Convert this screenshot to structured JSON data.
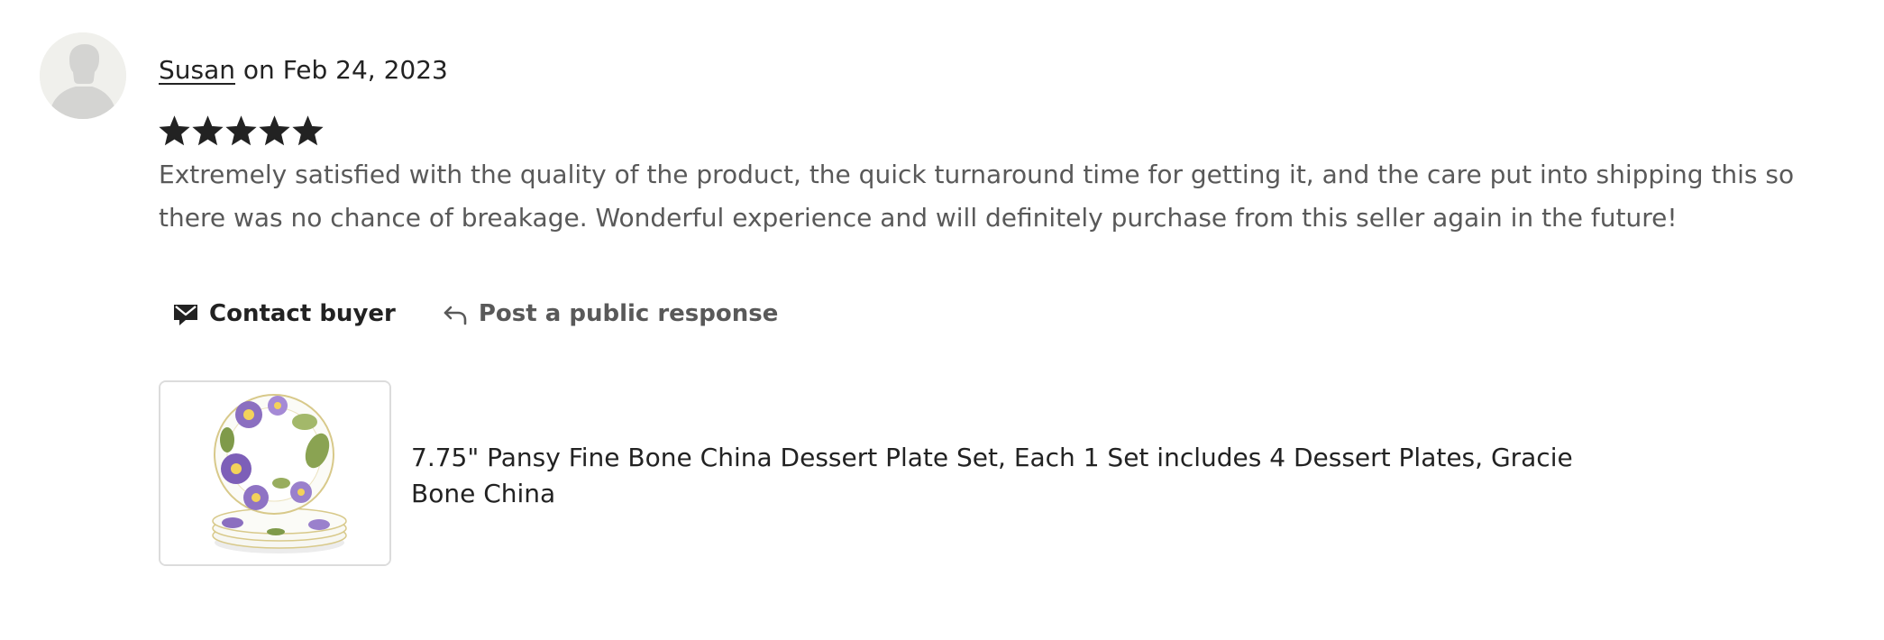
{
  "review": {
    "reviewer_name": "Susan",
    "date_text": "on Feb 24, 2023",
    "rating": 5,
    "rating_max": 5,
    "text": "Extremely satisfied with the quality of the product, the quick turnaround time for getting it, and the care put into shipping this so there was no chance of breakage. Wonderful experience and will definitely purchase from this seller again in the future!"
  },
  "actions": {
    "contact_buyer_label": "Contact buyer",
    "public_response_label": "Post a public response"
  },
  "product": {
    "title": "7.75\" Pansy Fine Bone China Dessert Plate Set, Each 1 Set includes 4 Dessert Plates, Gracie Bone China"
  },
  "icons": {
    "avatar": "user-silhouette-icon",
    "star": "star-icon",
    "contact": "envelope-icon",
    "respond": "reply-arrow-icon"
  },
  "colors": {
    "text_primary": "#222222",
    "text_secondary": "#595959",
    "star": "#222222",
    "avatar_bg": "#f0f0ec",
    "avatar_figure": "#d4d4d2",
    "thumb_border": "#dcdcdc"
  }
}
